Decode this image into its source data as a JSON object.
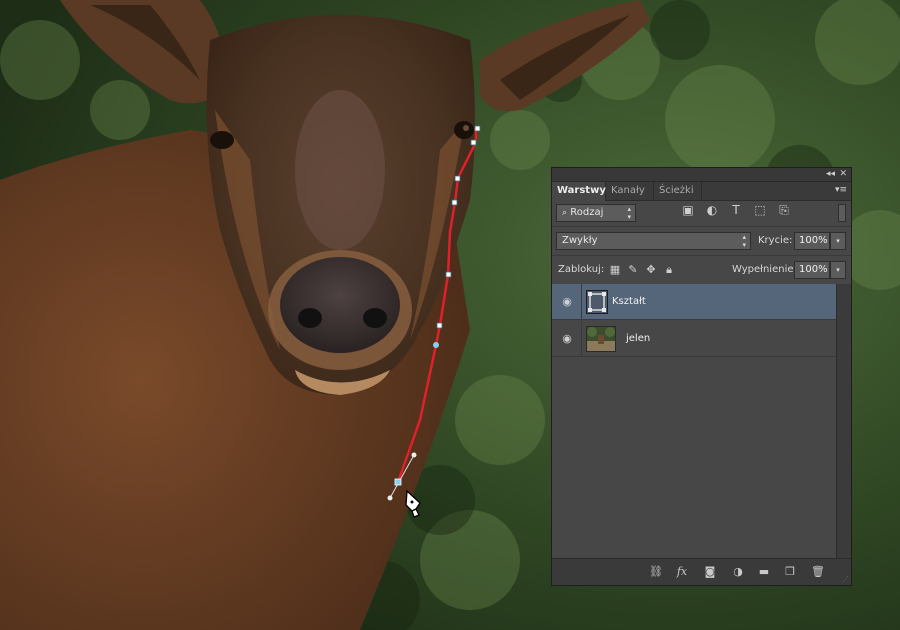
{
  "panel": {
    "tabs": [
      {
        "label": "Warstwy",
        "active": true
      },
      {
        "label": "Kanały",
        "active": false
      },
      {
        "label": "Ścieżki",
        "active": false
      }
    ],
    "filter": {
      "label": "Rodzaj"
    },
    "blend_mode": "Zwykły",
    "opacity_label": "Krycie:",
    "opacity_value": "100%",
    "lock_label": "Zablokuj:",
    "fill_label": "Wypełnienie:",
    "fill_value": "100%",
    "layers": [
      {
        "name": "Kształt",
        "visible": true,
        "selected": true,
        "type": "shape"
      },
      {
        "name": "jelen",
        "visible": true,
        "selected": false,
        "type": "photo"
      }
    ],
    "bottom_icons": [
      "link-icon",
      "fx-icon",
      "mask-icon",
      "adjustment-icon",
      "folder-icon",
      "new-layer-icon",
      "trash-icon"
    ],
    "fx_label": "fx"
  },
  "colors": {
    "path_stroke": "#e0202a",
    "anchor": "#7fd3f0",
    "selected_layer": "#55657a",
    "panel_bg": "#474747"
  },
  "tool": "pen-tool-icon"
}
